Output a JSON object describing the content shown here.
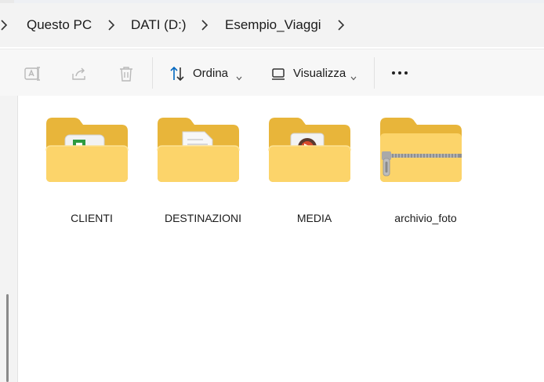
{
  "breadcrumb": {
    "items": [
      "Questo PC",
      "DATI (D:)",
      "Esempio_Viaggi"
    ]
  },
  "commandbar": {
    "sort_label": "Ordina",
    "view_label": "Visualizza",
    "more_label": "•••"
  },
  "content": {
    "items": [
      {
        "name": "CLIENTI",
        "kind": "folder",
        "preview": "spreadsheet-icon"
      },
      {
        "name": "DESTINAZIONI",
        "kind": "folder",
        "preview": "document-icon"
      },
      {
        "name": "MEDIA",
        "kind": "folder",
        "preview": "media-icon"
      },
      {
        "name": "archivio_foto",
        "kind": "zip-folder",
        "preview": "zipper-icon"
      }
    ]
  },
  "colors": {
    "folder_back": "#e8b53a",
    "folder_front": "#fcd46a",
    "accent": "#0067c0"
  }
}
